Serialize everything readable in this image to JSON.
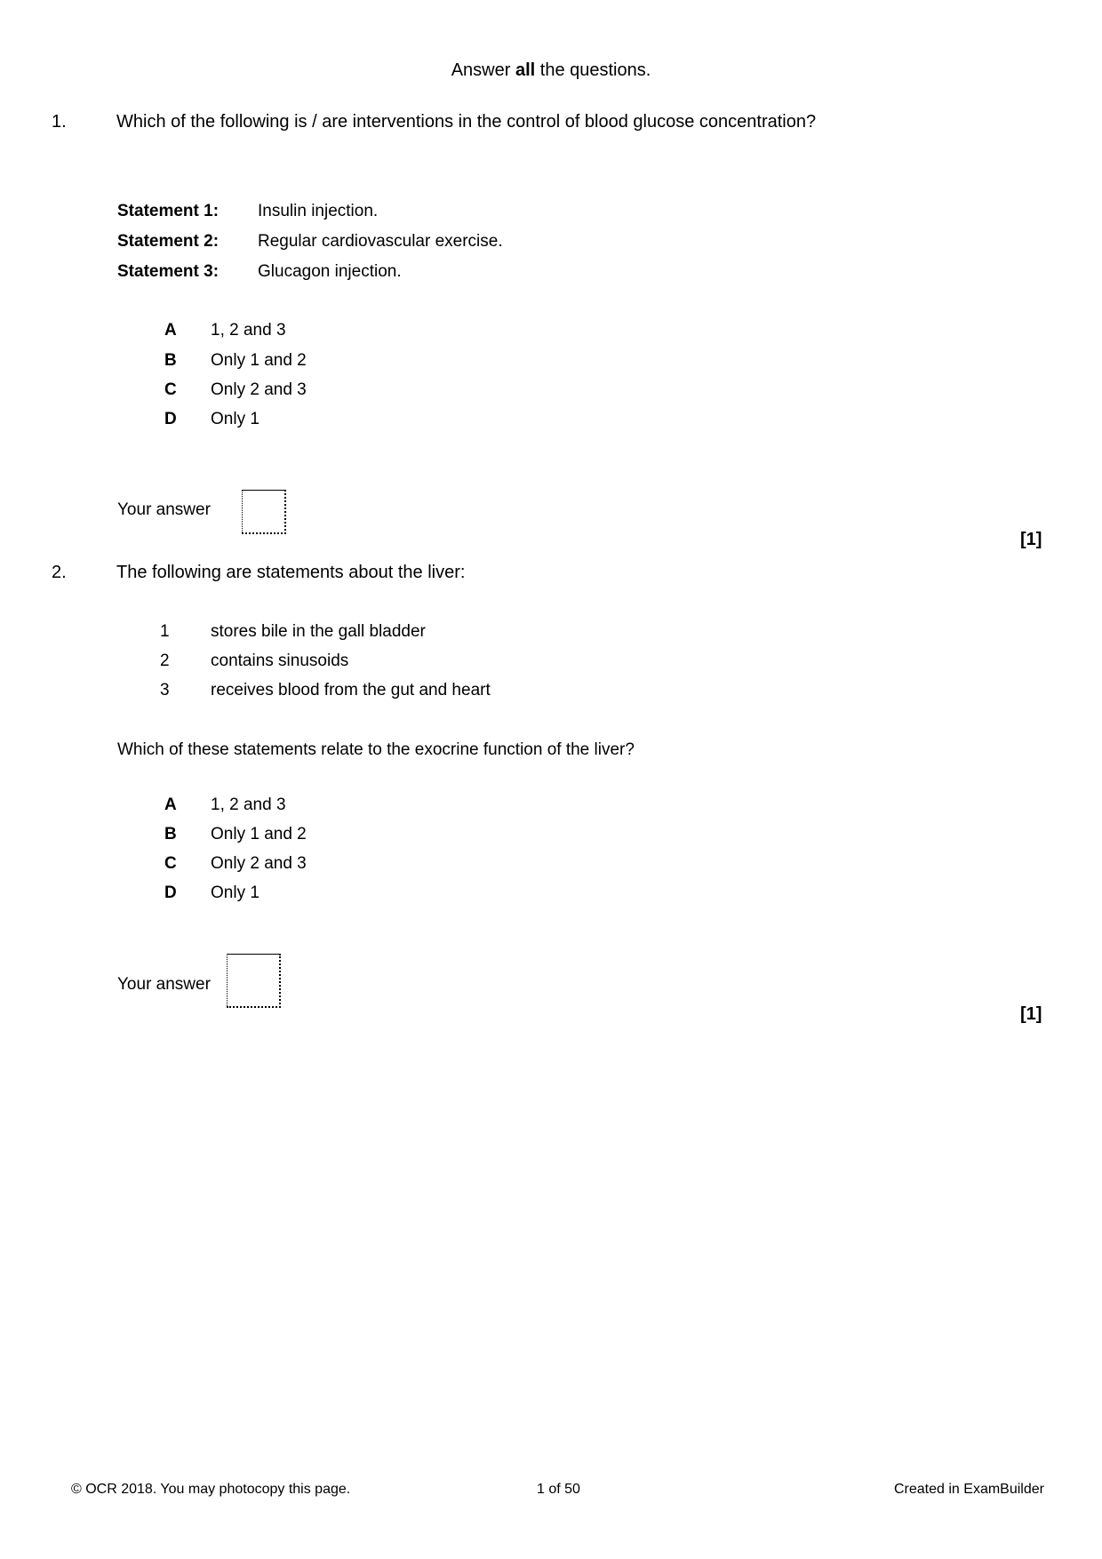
{
  "instructions": {
    "prefix": "Answer ",
    "emphasis": "all",
    "suffix": " the questions."
  },
  "questions": [
    {
      "number": "1.",
      "stem": "Which of the following is / are interventions in the control of blood glucose concentration?",
      "statements": [
        {
          "label": "Statement 1:",
          "text": "Insulin injection."
        },
        {
          "label": "Statement 2:",
          "text": "Regular cardiovascular exercise."
        },
        {
          "label": "Statement 3:",
          "text": "Glucagon injection."
        }
      ],
      "options": [
        {
          "letter": "A",
          "text": "1, 2 and 3"
        },
        {
          "letter": "B",
          "text": "Only 1 and 2"
        },
        {
          "letter": "C",
          "text": "Only 2 and 3"
        },
        {
          "letter": "D",
          "text": "Only 1"
        }
      ],
      "answer_label": "Your answer",
      "answer_value": "",
      "marks": "[1]"
    },
    {
      "number": "2.",
      "stem": "The following are statements about the liver:",
      "statements": [
        {
          "label": "1",
          "text": "stores bile in the gall bladder"
        },
        {
          "label": "2",
          "text": "contains sinusoids"
        },
        {
          "label": "3",
          "text": "receives blood from the gut and heart"
        }
      ],
      "sub_question": "Which of these statements relate to the exocrine function of the liver?",
      "options": [
        {
          "letter": "A",
          "text": "1, 2 and 3"
        },
        {
          "letter": "B",
          "text": "Only 1 and 2"
        },
        {
          "letter": "C",
          "text": "Only 2 and 3"
        },
        {
          "letter": "D",
          "text": "Only 1"
        }
      ],
      "answer_label": "Your answer",
      "answer_value": "",
      "marks": "[1]"
    }
  ],
  "footer": {
    "copyright": "© OCR 2018. You may photocopy this page.",
    "page": "1 of 50",
    "credit": "Created in ExamBuilder"
  }
}
